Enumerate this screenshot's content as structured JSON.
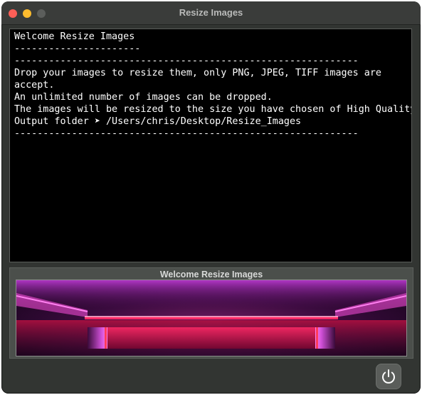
{
  "window": {
    "title": "Resize Images"
  },
  "console": {
    "lines": [
      "Welcome Resize Images",
      "----------------------",
      "------------------------------------------------------------",
      "Drop your images to resize them, only PNG, JPEG, TIFF images are",
      "accept.",
      "An unlimited number of images can be dropped.",
      "The images will be resized to the size you have chosen of High Quality.",
      "Output folder ➤ /Users/chris/Desktop/Resize_Images",
      "------------------------------------------------------------"
    ]
  },
  "preview": {
    "label": "Welcome Resize Images"
  },
  "icons": {
    "close": "traffic-light-close",
    "minimize": "traffic-light-minimize",
    "maximize": "traffic-light-maximize",
    "power": "power-icon"
  },
  "colors": {
    "close": "#fe5f57",
    "minimize": "#febc2e",
    "console_bg": "#000000",
    "console_text": "#ffffff",
    "neon_magenta": "#ff40d0",
    "neon_red": "#e8104a"
  }
}
